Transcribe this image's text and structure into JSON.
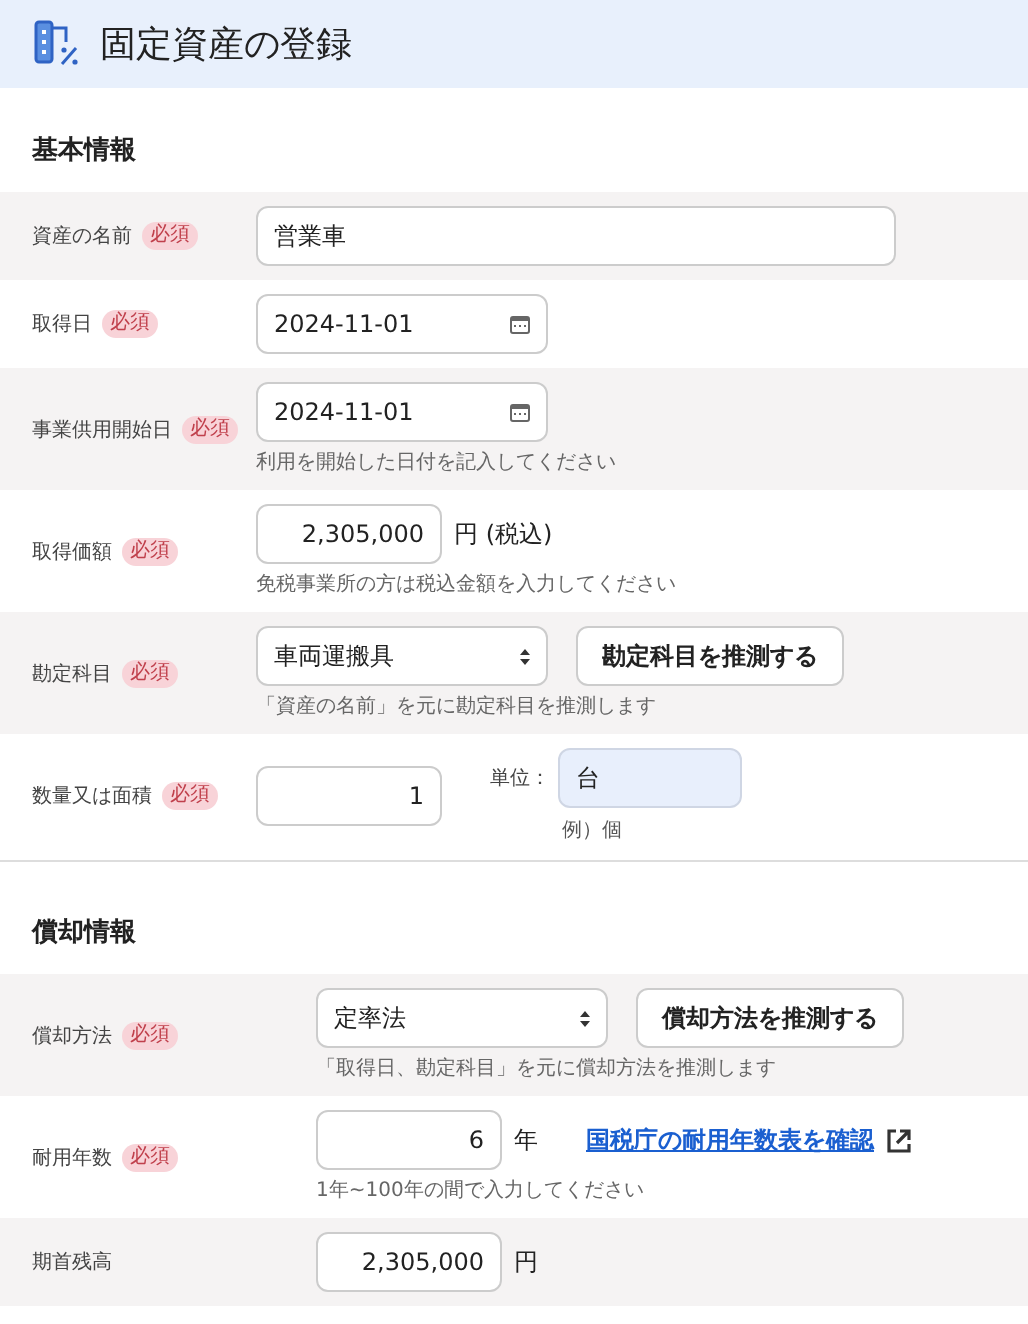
{
  "header": {
    "title": "固定資産の登録"
  },
  "sections": [
    {
      "title": "基本情報",
      "rows": [
        {
          "label": "資産の名前",
          "required_badge": "必須",
          "control": {
            "kind": "text",
            "value": "営業車"
          }
        },
        {
          "label": "取得日",
          "required_badge": "必須",
          "control": {
            "kind": "date",
            "value": "2024-11-01"
          }
        },
        {
          "label": "事業供用開始日",
          "required_badge": "必須",
          "control": {
            "kind": "date",
            "value": "2024-11-01"
          },
          "hint": "利用を開始した日付を記入してください"
        },
        {
          "label": "取得価額",
          "required_badge": "必須",
          "control": {
            "kind": "number",
            "value": "2,305,000"
          },
          "suffix": "円 (税込)",
          "hint": "免税事業所の方は税込金額を入力してください"
        },
        {
          "label": "勘定科目",
          "required_badge": "必須",
          "control": {
            "kind": "select",
            "value": "車両運搬具"
          },
          "button": "勘定科目を推測する",
          "hint": "「資産の名前」を元に勘定科目を推測します"
        },
        {
          "label": "数量又は面積",
          "required_badge": "必須",
          "control": {
            "kind": "number",
            "value": "1"
          },
          "unit": {
            "label": "単位：",
            "value": "台",
            "example": "例）個"
          }
        }
      ]
    },
    {
      "title": "償却情報",
      "rows": [
        {
          "label": "償却方法",
          "required_badge": "必須",
          "control": {
            "kind": "select",
            "value": "定率法"
          },
          "button": "償却方法を推測する",
          "hint": "「取得日、勘定科目」を元に償却方法を推測します"
        },
        {
          "label": "耐用年数",
          "required_badge": "必須",
          "control": {
            "kind": "number",
            "value": "6"
          },
          "suffix": "年",
          "link": "国税庁の耐用年数表を確認",
          "hint": "1年~100年の間で入力してください"
        },
        {
          "label": "期首残高",
          "control": {
            "kind": "number",
            "value": "2,305,000"
          },
          "suffix": "円"
        }
      ]
    }
  ]
}
